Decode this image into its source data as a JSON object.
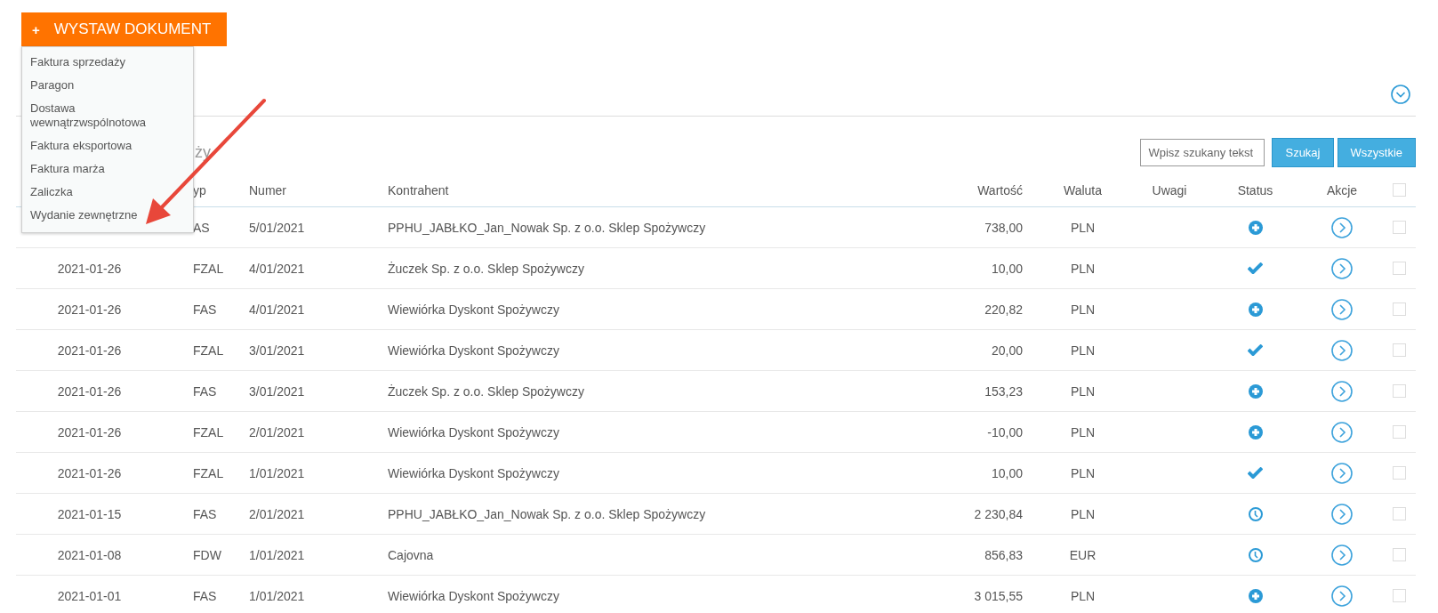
{
  "new_document_button": {
    "icon": "+",
    "label": "WYSTAW DOKUMENT"
  },
  "document_menu": [
    {
      "label": "Faktura sprzedaży"
    },
    {
      "label": "Paragon"
    },
    {
      "label": "Dostawa wewnątrzwspólnotowa"
    },
    {
      "label": "Faktura eksportowa"
    },
    {
      "label": "Faktura marża"
    },
    {
      "label": "Zaliczka"
    },
    {
      "label": "Wydanie zewnętrzne"
    }
  ],
  "section_title": "ży",
  "search": {
    "placeholder": "Wpisz szukany tekst",
    "buttons": [
      "Szukaj",
      "Wszystkie"
    ]
  },
  "table": {
    "columns": [
      "",
      "yp",
      "Numer",
      "Kontrahent",
      "Wartość",
      "Waluta",
      "Uwagi",
      "Status",
      "Akcje"
    ],
    "select_all_checked": false,
    "rows": [
      {
        "date": "",
        "type": "AS",
        "number": "5/01/2021",
        "contractor": "PPHU_JABŁKO_Jan_Nowak Sp. z o.o. Sklep Spożywczy",
        "value": "738,00",
        "currency": "PLN",
        "kind": "new",
        "checked": false
      },
      {
        "date": "2021-01-26",
        "type": "FZAL",
        "number": "4/01/2021",
        "contractor": "Żuczek Sp. z o.o. Sklep Spożywczy",
        "value": "10,00",
        "currency": "PLN",
        "kind": "paid",
        "checked": false
      },
      {
        "date": "2021-01-26",
        "type": "FAS",
        "number": "4/01/2021",
        "contractor": "Wiewiórka Dyskont Spożywczy",
        "value": "220,82",
        "currency": "PLN",
        "kind": "new",
        "checked": false
      },
      {
        "date": "2021-01-26",
        "type": "FZAL",
        "number": "3/01/2021",
        "contractor": "Wiewiórka Dyskont Spożywczy",
        "value": "20,00",
        "currency": "PLN",
        "kind": "paid",
        "checked": false
      },
      {
        "date": "2021-01-26",
        "type": "FAS",
        "number": "3/01/2021",
        "contractor": "Żuczek Sp. z o.o. Sklep Spożywczy",
        "value": "153,23",
        "currency": "PLN",
        "kind": "new",
        "checked": false
      },
      {
        "date": "2021-01-26",
        "type": "FZAL",
        "number": "2/01/2021",
        "contractor": "Wiewiórka Dyskont Spożywczy",
        "value": "-10,00",
        "currency": "PLN",
        "kind": "new",
        "checked": false
      },
      {
        "date": "2021-01-26",
        "type": "FZAL",
        "number": "1/01/2021",
        "contractor": "Wiewiórka Dyskont Spożywczy",
        "value": "10,00",
        "currency": "PLN",
        "kind": "paid",
        "checked": false
      },
      {
        "date": "2021-01-15",
        "type": "FAS",
        "number": "2/01/2021",
        "contractor": "PPHU_JABŁKO_Jan_Nowak Sp. z o.o. Sklep Spożywczy",
        "value": "2 230,84",
        "currency": "PLN",
        "kind": "pending",
        "checked": false
      },
      {
        "date": "2021-01-08",
        "type": "FDW",
        "number": "1/01/2021",
        "contractor": "Cajovna",
        "value": "856,83",
        "currency": "EUR",
        "kind": "pending",
        "checked": false
      },
      {
        "date": "2021-01-01",
        "type": "FAS",
        "number": "1/01/2021",
        "contractor": "Wiewiórka Dyskont Spożywczy",
        "value": "3 015,55",
        "currency": "PLN",
        "kind": "new",
        "checked": false
      }
    ]
  }
}
